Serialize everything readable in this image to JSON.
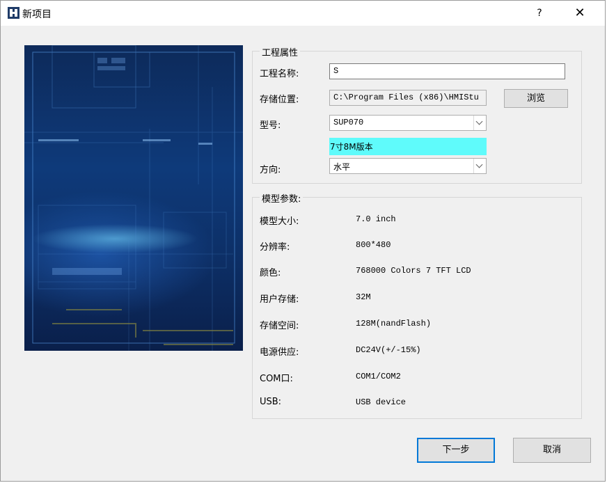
{
  "window": {
    "title": "新项目",
    "help": "?",
    "close": "✕"
  },
  "project": {
    "legend": "工程属性",
    "name_label": "工程名称:",
    "name_value": "S",
    "location_label": "存储位置:",
    "location_value": "C:\\Program Files (x86)\\HMIStu",
    "browse": "浏览",
    "model_label": "型号:",
    "model_value": "SUP070",
    "model_hint": "7寸8M版本",
    "orientation_label": "方向:",
    "orientation_value": "水平"
  },
  "params": {
    "legend": "模型参数:",
    "rows": [
      {
        "label": "模型大小:",
        "value": "7.0 inch"
      },
      {
        "label": "分辨率:",
        "value": "800*480"
      },
      {
        "label": "颜色:",
        "value": "768000 Colors 7 TFT LCD"
      },
      {
        "label": "用户存储:",
        "value": "32M"
      },
      {
        "label": "存储空间:",
        "value": "128M(nandFlash)"
      },
      {
        "label": "电源供应:",
        "value": "DC24V(+/-15%)"
      },
      {
        "label": "COM口:",
        "value": "COM1/COM2"
      },
      {
        "label": "USB:",
        "value": "USB device"
      }
    ]
  },
  "footer": {
    "next": "下一步",
    "cancel": "取消"
  },
  "colors": {
    "accent": "#0078d7",
    "hint_bg": "#5ffbfb",
    "preview_bg": "#0e3a7a"
  }
}
